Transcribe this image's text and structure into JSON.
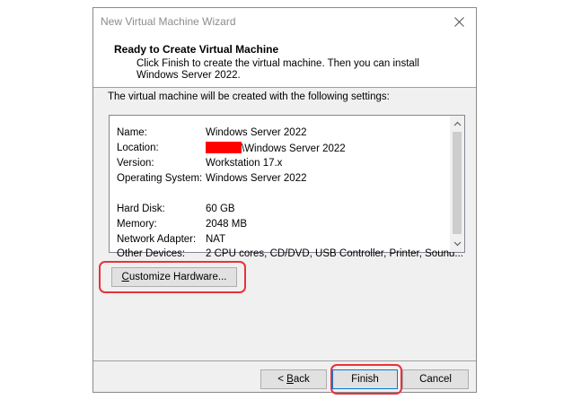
{
  "window": {
    "title": "New Virtual Machine Wizard"
  },
  "header": {
    "title": "Ready to Create Virtual Machine",
    "subtitle": "Click Finish to create the virtual machine. Then you can install Windows Server 2022."
  },
  "intro_text": "The virtual machine will be created with the following settings:",
  "settings": [
    {
      "label": "Name:",
      "value": "Windows Server 2022"
    },
    {
      "label": "Location:",
      "value": "\\Windows Server 2022",
      "redacted_prefix": true
    },
    {
      "label": "Version:",
      "value": "Workstation 17.x"
    },
    {
      "label": "Operating System:",
      "value": "Windows Server 2022"
    },
    {
      "label": "Hard Disk:",
      "value": "60 GB"
    },
    {
      "label": "Memory:",
      "value": "2048 MB"
    },
    {
      "label": "Network Adapter:",
      "value": "NAT"
    },
    {
      "label": "Other Devices:",
      "value": "2 CPU cores, CD/DVD, USB Controller, Printer, Sound..."
    }
  ],
  "buttons": {
    "customize": {
      "underlined": "C",
      "rest": "ustomize Hardware..."
    },
    "back": {
      "prefix": "< ",
      "underlined": "B",
      "rest": "ack"
    },
    "finish": "Finish",
    "cancel": "Cancel"
  },
  "colors": {
    "highlight": "#e8323c",
    "redaction": "#ff0000",
    "dialog_bg": "#f0f0f0",
    "default_button_border": "#0078d7"
  }
}
